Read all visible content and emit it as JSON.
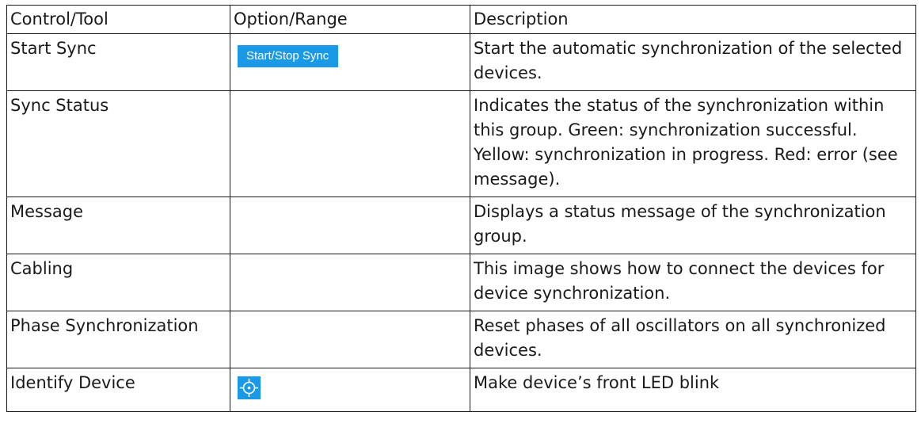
{
  "table": {
    "headers": [
      "Control/Tool",
      "Option/Range",
      "Description"
    ],
    "rows": [
      {
        "control": "Start Sync",
        "option": "Start/Stop Sync",
        "description": "Start the automatic synchronization of the selected devices."
      },
      {
        "control": "Sync Status",
        "option": "",
        "description": "Indicates the status of the synchronization within this group. Green: synchronization successful. Yellow: synchronization in progress. Red: error (see message)."
      },
      {
        "control": "Message",
        "option": "",
        "description": "Displays a status message of the synchronization group."
      },
      {
        "control": "Cabling",
        "option": "",
        "description": "This image shows how to connect the devices for device synchronization."
      },
      {
        "control": "Phase Synchronization",
        "option": "",
        "description": "Reset phases of all oscillators on all synchronized devices."
      },
      {
        "control": "Identify Device",
        "option": "",
        "description": "Make device’s front LED blink"
      }
    ]
  },
  "icons": {
    "identify_device": "crosshair-target-icon"
  },
  "colors": {
    "button_blue": "#1a9ae6",
    "button_text": "#ffffff",
    "border": "#1a1a1a"
  }
}
